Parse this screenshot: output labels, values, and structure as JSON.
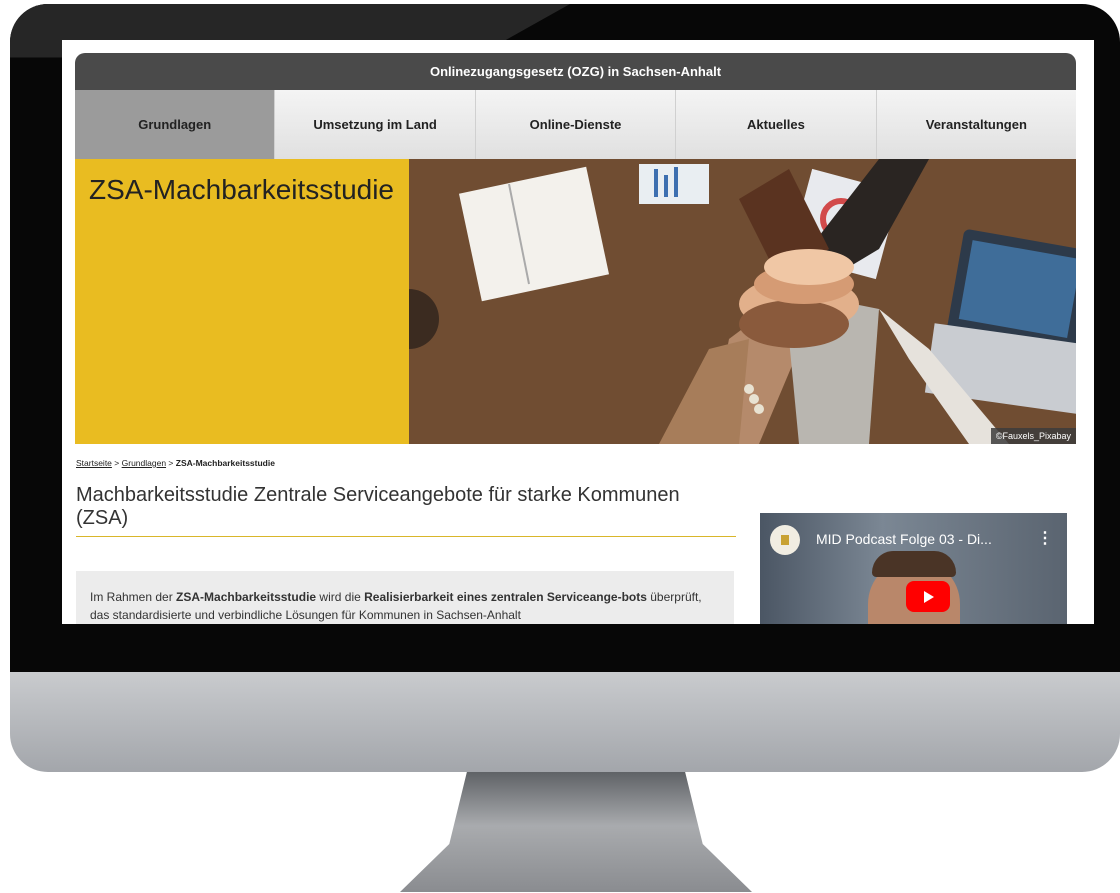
{
  "site": {
    "header_title": "Onlinezugangsgesetz (OZG) in Sachsen-Anhalt"
  },
  "nav": {
    "tabs": [
      {
        "label": "Grundlagen",
        "active": true
      },
      {
        "label": "Umsetzung im Land",
        "active": false
      },
      {
        "label": "Online-Dienste",
        "active": false
      },
      {
        "label": "Aktuelles",
        "active": false
      },
      {
        "label": "Veranstaltungen",
        "active": false
      }
    ]
  },
  "hero": {
    "title": "ZSA-Machbarkeitsstudie",
    "photo_credit": "©Fauxels_Pixabay",
    "accent_color": "#e9bc21"
  },
  "breadcrumb": {
    "home": "Startseite",
    "separator": ">",
    "parent": "Grundlagen",
    "current": "ZSA-Machbarkeitsstudie"
  },
  "main": {
    "title": "Machbarkeitsstudie Zentrale Serviceangebote für starke Kommunen (ZSA)",
    "intro": {
      "t1": "Im Rahmen der ",
      "b1": "ZSA-Machbarkeitsstudie",
      "t2": " wird die ",
      "b2": "Realisierbarkeit eines zentralen Serviceange-bots",
      "t3": " überprüft, das standardisierte und verbindliche Lösungen für Kommunen in Sachsen-Anhalt"
    }
  },
  "video": {
    "title": "MID Podcast Folge 03 - Di...",
    "menu_icon": "more-vert-icon",
    "play_icon": "youtube-play-icon"
  }
}
